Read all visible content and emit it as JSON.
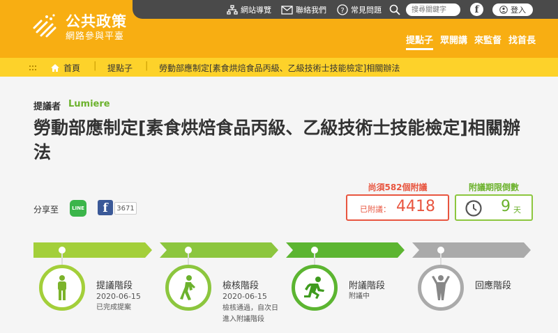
{
  "header": {
    "logo_title": "公共政策",
    "logo_subtitle": "網路參與平臺",
    "topbar": {
      "sitemap_label": "網站導覽",
      "contact_label": "聯絡我們",
      "faq_label": "常見問題",
      "search_placeholder": "搜尋關鍵字",
      "facebook_glyph": "f",
      "login_label": "登入"
    },
    "nav": [
      {
        "label": "提點子",
        "active": true
      },
      {
        "label": "眾開講",
        "active": false
      },
      {
        "label": "來監督",
        "active": false
      },
      {
        "label": "找首長",
        "active": false
      }
    ],
    "brand_color": "#f8ae12"
  },
  "breadcrumb": {
    "home": "首頁",
    "section": "提點子",
    "current": "勞動部應制定[素食烘焙食品丙級、乙級技術士技能檢定]相關辦法"
  },
  "proposal": {
    "proposer_label": "提議者",
    "proposer_name": "Lumiere",
    "title": "勞動部應制定[素食烘焙食品丙級、乙級技術士技能檢定]相關辦法"
  },
  "share": {
    "label": "分享至",
    "line_label": "LINE",
    "facebook_glyph": "f",
    "facebook_count": "3671"
  },
  "stats": {
    "need_label": "尚須582個附議",
    "votes_label": "已附議：",
    "votes_value": "4418",
    "countdown_label": "附議期限倒數",
    "countdown_value": "9",
    "countdown_unit": "天"
  },
  "stages": [
    {
      "name": "提議階段",
      "date": "2020-06-15",
      "status": "已完成提案",
      "color": "#a3cf3a"
    },
    {
      "name": "檢核階段",
      "date": "2020-06-15",
      "status": "檢核通過，自次日進入附議階段",
      "color": "#8cc63e"
    },
    {
      "name": "附議階段",
      "date": "",
      "status": "附議中",
      "color": "#5cb531"
    },
    {
      "name": "回應階段",
      "date": "",
      "status": "",
      "color": "#aaaaaa"
    }
  ]
}
